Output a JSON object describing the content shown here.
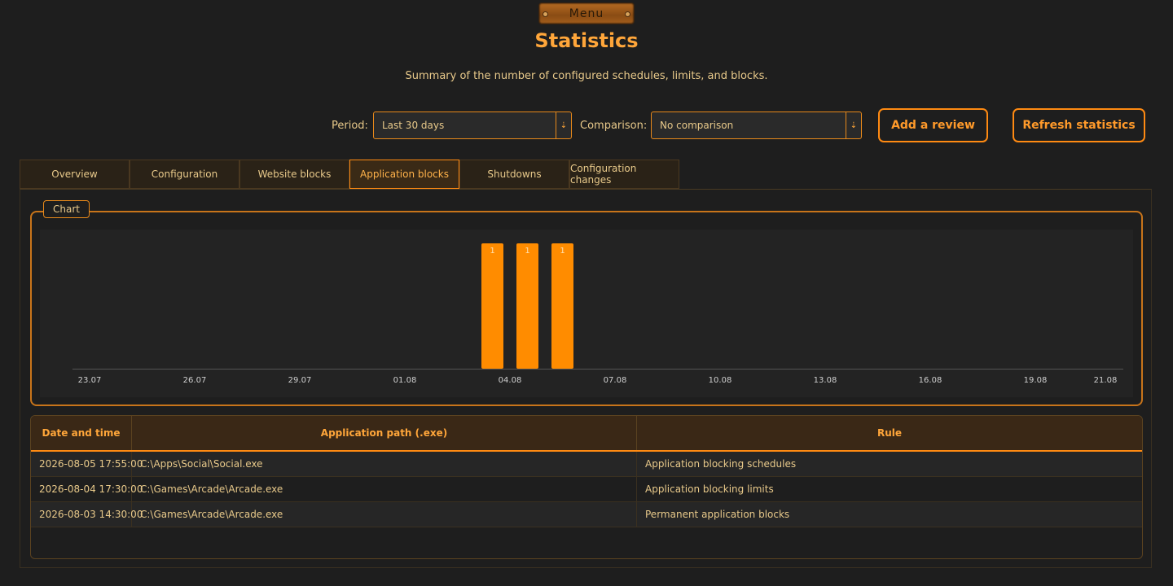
{
  "header": {
    "menu_label": "Menu",
    "title": "Statistics",
    "subtitle": "Summary of the number of configured schedules, limits, and blocks."
  },
  "filters": {
    "period_label": "Period:",
    "period_value": "Last 30 days",
    "comparison_label": "Comparison:",
    "comparison_value": "No comparison"
  },
  "actions": {
    "add_review": "Add a review",
    "refresh": "Refresh statistics"
  },
  "tabs": [
    {
      "label": "Overview",
      "active": false
    },
    {
      "label": "Configuration",
      "active": false
    },
    {
      "label": "Website blocks",
      "active": false
    },
    {
      "label": "Application blocks",
      "active": true
    },
    {
      "label": "Shutdowns",
      "active": false
    },
    {
      "label": "Configuration changes",
      "active": false
    }
  ],
  "chart_group_label": "Chart",
  "chart_data": {
    "type": "bar",
    "x_ticks": [
      "23.07",
      "26.07",
      "29.07",
      "01.08",
      "04.08",
      "07.08",
      "10.08",
      "13.08",
      "16.08",
      "19.08",
      "21.08"
    ],
    "date_range": [
      "23.07",
      "21.08"
    ],
    "bars": [
      {
        "date": "03.08",
        "value": 1
      },
      {
        "date": "04.08",
        "value": 1
      },
      {
        "date": "05.08",
        "value": 1
      }
    ],
    "ylim": [
      0,
      1
    ],
    "bar_color": "#ff8c00",
    "grid": false
  },
  "table": {
    "columns": [
      "Date and time",
      "Application path (.exe)",
      "Rule"
    ],
    "rows": [
      [
        "2026-08-05 17:55:00",
        "C:\\Apps\\Social\\Social.exe",
        "Application blocking schedules"
      ],
      [
        "2026-08-04 17:30:00",
        "C:\\Games\\Arcade\\Arcade.exe",
        "Application blocking limits"
      ],
      [
        "2026-08-03 14:30:00",
        "C:\\Games\\Arcade\\Arcade.exe",
        "Permanent application blocks"
      ]
    ]
  },
  "colors": {
    "accent": "#ff8a12",
    "text": "#e8c98a",
    "background": "#1e1e1e"
  }
}
